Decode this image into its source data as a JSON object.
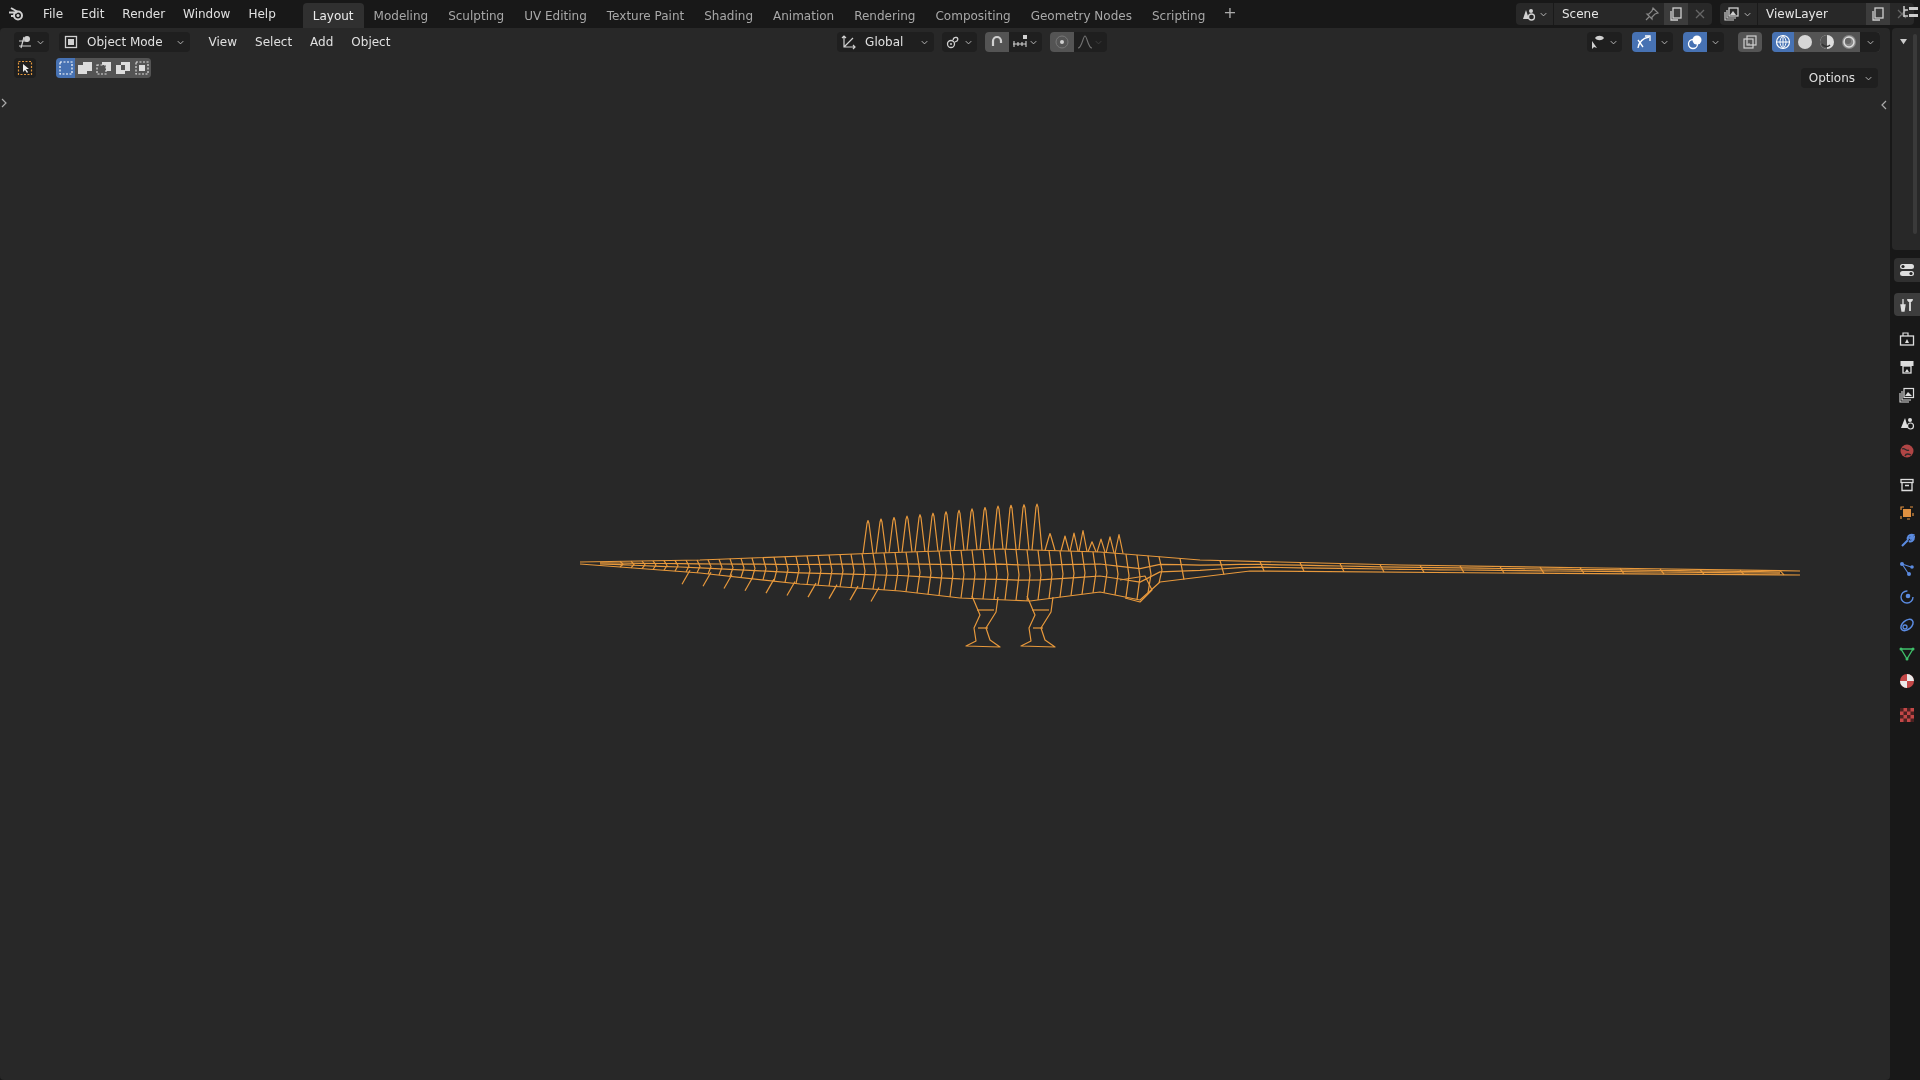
{
  "top_bar": {
    "menus": [
      "File",
      "Edit",
      "Render",
      "Window",
      "Help"
    ],
    "workspace_tabs": [
      {
        "label": "Layout",
        "selected": true
      },
      {
        "label": "Modeling",
        "selected": false
      },
      {
        "label": "Sculpting",
        "selected": false
      },
      {
        "label": "UV Editing",
        "selected": false
      },
      {
        "label": "Texture Paint",
        "selected": false
      },
      {
        "label": "Shading",
        "selected": false
      },
      {
        "label": "Animation",
        "selected": false
      },
      {
        "label": "Rendering",
        "selected": false
      },
      {
        "label": "Compositing",
        "selected": false
      },
      {
        "label": "Geometry Nodes",
        "selected": false
      },
      {
        "label": "Scripting",
        "selected": false
      }
    ],
    "add_tab": "+",
    "scene": {
      "name": "Scene"
    },
    "view_layer": {
      "name": "ViewLayer"
    }
  },
  "viewport_header": {
    "mode": "Object Mode",
    "menus": [
      "View",
      "Select",
      "Add",
      "Object"
    ],
    "orientation": "Global",
    "snap": {
      "on": false
    },
    "proportional_editing": {
      "on": false
    },
    "gizmos": {
      "on": true
    },
    "overlays": {
      "on": true
    },
    "xray": {
      "on": false
    },
    "shading": [
      {
        "kind": "wireframe",
        "selected": true
      },
      {
        "kind": "solid",
        "selected": false
      },
      {
        "kind": "material",
        "selected": false
      },
      {
        "kind": "rendered",
        "selected": false
      }
    ]
  },
  "tool_settings": {
    "select_modes": [
      {
        "selected": true
      },
      {
        "selected": false
      },
      {
        "selected": false
      },
      {
        "selected": false
      },
      {
        "selected": false
      }
    ],
    "options": "Options"
  },
  "properties_tabs": [
    {
      "kind": "tool",
      "selected": true
    },
    {
      "kind": "render",
      "selected": false
    },
    {
      "kind": "output",
      "selected": false
    },
    {
      "kind": "view_layer",
      "selected": false
    },
    {
      "kind": "scene",
      "selected": false
    },
    {
      "kind": "world",
      "selected": false
    },
    {
      "kind": "collection",
      "selected": false
    },
    {
      "kind": "object",
      "selected": false
    },
    {
      "kind": "modifiers",
      "selected": false
    },
    {
      "kind": "particles",
      "selected": false
    },
    {
      "kind": "physics",
      "selected": false
    },
    {
      "kind": "constraints",
      "selected": false
    },
    {
      "kind": "data",
      "selected": false
    },
    {
      "kind": "material",
      "selected": false
    },
    {
      "kind": "texture",
      "selected": false
    }
  ]
}
